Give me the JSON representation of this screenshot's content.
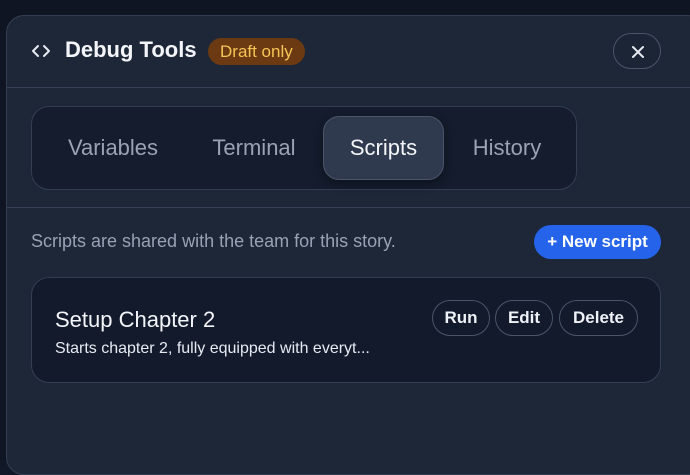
{
  "header": {
    "title": "Debug Tools",
    "badge": "Draft only",
    "icon": "code-icon",
    "close_icon": "close-icon"
  },
  "tabs": [
    {
      "label": "Variables",
      "active": false
    },
    {
      "label": "Terminal",
      "active": false
    },
    {
      "label": "Scripts",
      "active": true
    },
    {
      "label": "History",
      "active": false
    }
  ],
  "scripts_panel": {
    "info": "Scripts are shared with the team for this story.",
    "new_button_label": "+ New script",
    "items": [
      {
        "title": "Setup Chapter 2",
        "description": "Starts chapter 2, fully equipped with everyt...",
        "actions": {
          "run": "Run",
          "edit": "Edit",
          "delete": "Delete"
        }
      }
    ]
  },
  "colors": {
    "accent": "#2563eb",
    "badge_bg": "#6b3a12",
    "badge_text": "#f6c454"
  }
}
